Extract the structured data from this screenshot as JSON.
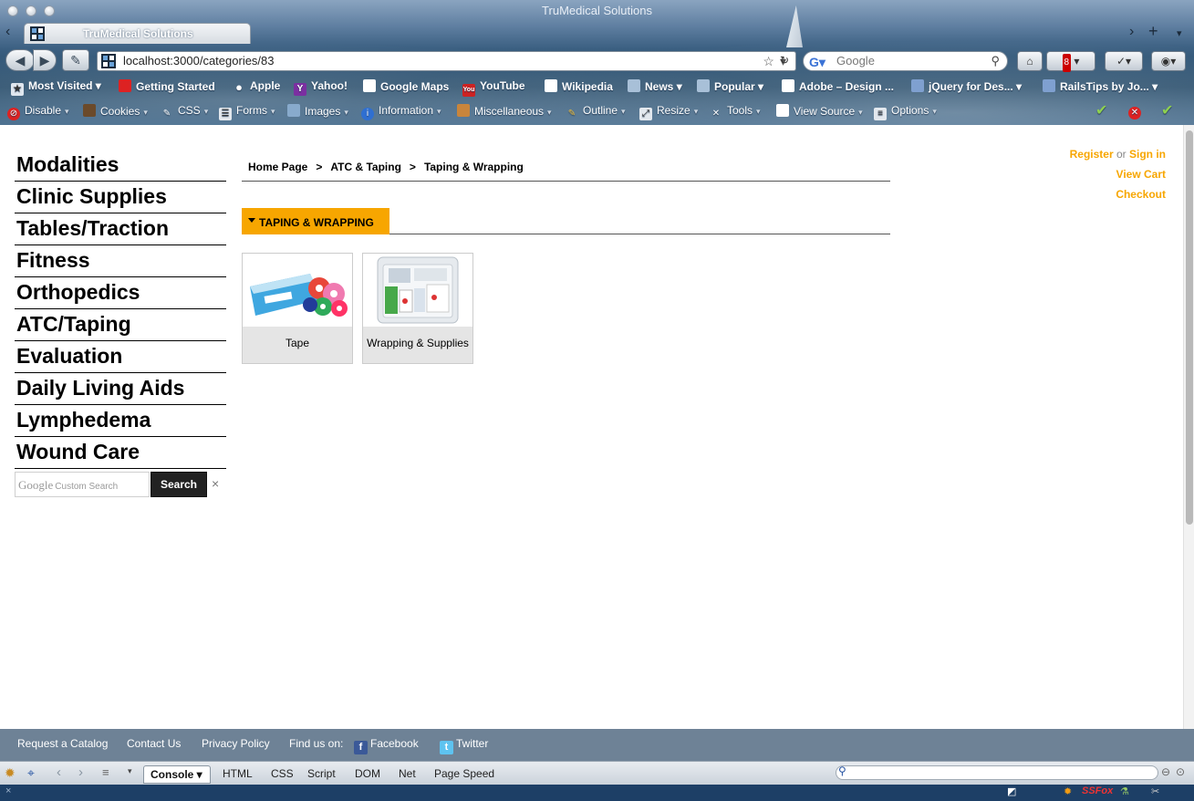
{
  "window": {
    "title": "TruMedical Solutions"
  },
  "tab": {
    "label": "TruMedical Solutions"
  },
  "navigation": {
    "url": "localhost:3000/categories/83",
    "search_placeholder": "Google",
    "notification_count": "8"
  },
  "bookmarks": [
    {
      "label": "Most Visited",
      "icon": "most-visited-icon"
    },
    {
      "label": "Getting Started",
      "icon": "getting-started-icon"
    },
    {
      "label": "Apple",
      "icon": "apple-icon"
    },
    {
      "label": "Yahoo!",
      "icon": "yahoo-icon"
    },
    {
      "label": "Google Maps",
      "icon": "page-icon"
    },
    {
      "label": "YouTube",
      "icon": "youtube-icon"
    },
    {
      "label": "Wikipedia",
      "icon": "page-icon"
    },
    {
      "label": "News",
      "icon": "folder-icon"
    },
    {
      "label": "Popular",
      "icon": "folder-icon"
    },
    {
      "label": "Adobe – Design ...",
      "icon": "page-icon"
    },
    {
      "label": "jQuery for Des...",
      "icon": "rss-icon"
    },
    {
      "label": "RailsTips by Jo...",
      "icon": "rss-icon"
    }
  ],
  "devtoolbar": [
    {
      "label": "Disable",
      "icon": "disable-icon"
    },
    {
      "label": "Cookies",
      "icon": "cookies-icon"
    },
    {
      "label": "CSS",
      "icon": "css-icon"
    },
    {
      "label": "Forms",
      "icon": "forms-icon"
    },
    {
      "label": "Images",
      "icon": "images-icon"
    },
    {
      "label": "Information",
      "icon": "information-icon"
    },
    {
      "label": "Miscellaneous",
      "icon": "miscellaneous-icon"
    },
    {
      "label": "Outline",
      "icon": "outline-icon"
    },
    {
      "label": "Resize",
      "icon": "resize-icon"
    },
    {
      "label": "Tools",
      "icon": "tools-icon"
    },
    {
      "label": "View Source",
      "icon": "view-source-icon"
    },
    {
      "label": "Options",
      "icon": "options-icon"
    }
  ],
  "sidebar": {
    "categories": [
      "Modalities",
      "Clinic Supplies",
      "Tables/Traction",
      "Fitness",
      "Orthopedics",
      "ATC/Taping",
      "Evaluation",
      "Daily Living Aids",
      "Lymphedema",
      "Wound Care"
    ],
    "search": {
      "watermark": "Google",
      "watermark_suffix": "Custom Search",
      "button_label": "Search",
      "clear_label": "×"
    }
  },
  "breadcrumb": {
    "items": [
      "Home Page",
      "ATC & Taping",
      "Taping & Wrapping"
    ],
    "separator": ">"
  },
  "section": {
    "title": "TAPING & WRAPPING"
  },
  "products": [
    {
      "name": "Tape"
    },
    {
      "name": "Wrapping & Supplies"
    }
  ],
  "account": {
    "register": "Register",
    "or": "or",
    "sign_in": "Sign in",
    "view_cart": "View Cart",
    "checkout": "Checkout"
  },
  "footer": {
    "links": [
      "Request a Catalog",
      "Contact Us",
      "Privacy Policy"
    ],
    "find_us": "Find us on:",
    "facebook": "Facebook",
    "twitter": "Twitter"
  },
  "firebug": {
    "console": "Console",
    "tabs": [
      "HTML",
      "CSS",
      "Script",
      "DOM",
      "Net",
      "Page Speed"
    ]
  },
  "colors": {
    "accent_orange": "#f7a600",
    "footer_bg": "#6e8296",
    "caption_bg": "#e5e5e5"
  }
}
